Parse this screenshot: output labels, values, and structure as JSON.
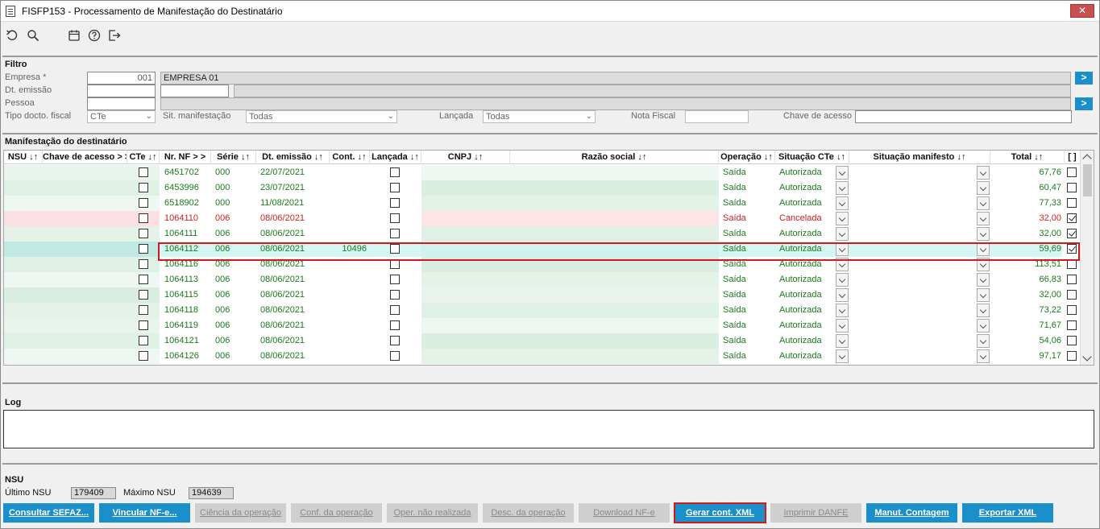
{
  "window": {
    "title": "FISFP153 - Processamento de Manifestação do Destinatário",
    "close_label": "✕"
  },
  "toolbar": {
    "icons": [
      "undo-icon",
      "search-icon",
      "calendar-icon",
      "help-icon",
      "exit-icon"
    ]
  },
  "filtro": {
    "section_title": "Filtro",
    "empresa_label": "Empresa *",
    "empresa_code": "001",
    "empresa_name": "EMPRESA 01",
    "dt_emissao_label": "Dt. emissão",
    "pessoa_label": "Pessoa",
    "tipo_docto_label": "Tipo docto. fiscal",
    "tipo_docto_value": "CTe",
    "sit_manifestacao_label": "Sit. manifestação",
    "sit_manifestacao_value": "Todas",
    "lancada_label": "Lançada",
    "lancada_value": "Todas",
    "nota_fiscal_label": "Nota Fiscal",
    "chave_acesso_label": "Chave de acesso",
    "nav_label": ">"
  },
  "manifestacao": {
    "section_title": "Manifestação do destinatário",
    "columns": {
      "nsu": "NSU ↓↑",
      "chave": "Chave de acesso > >",
      "cte": "CTe ↓↑",
      "nr_nf": "Nr. NF > >",
      "serie": "Série ↓↑",
      "dt_emissao": "Dt. emissão ↓↑",
      "cont": "Cont. ↓↑",
      "lancada": "Lançada ↓↑",
      "cnpj": "CNPJ ↓↑",
      "razao": "Razão social ↓↑",
      "operacao": "Operação ↓↑",
      "situacao_cte": "Situação CTe ↓↑",
      "situacao_manifesto": "Situação manifesto ↓↑",
      "total": "Total ↓↑",
      "sel": "[ ]"
    },
    "rows": [
      {
        "nr_nf": "6451702",
        "serie": "000",
        "dt": "22/07/2021",
        "cont": "",
        "operacao": "Saída",
        "situacao": "Autorizada",
        "total": "67,76",
        "checked": false,
        "status": "normal"
      },
      {
        "nr_nf": "6453996",
        "serie": "000",
        "dt": "23/07/2021",
        "cont": "",
        "operacao": "Saída",
        "situacao": "Autorizada",
        "total": "60,47",
        "checked": false,
        "status": "normal"
      },
      {
        "nr_nf": "6518902",
        "serie": "000",
        "dt": "11/08/2021",
        "cont": "",
        "operacao": "Saída",
        "situacao": "Autorizada",
        "total": "77,33",
        "checked": false,
        "status": "normal"
      },
      {
        "nr_nf": "1064110",
        "serie": "006",
        "dt": "08/06/2021",
        "cont": "",
        "operacao": "Saída",
        "situacao": "Cancelada",
        "total": "32,00",
        "checked": true,
        "status": "cancelled"
      },
      {
        "nr_nf": "1064111",
        "serie": "006",
        "dt": "08/06/2021",
        "cont": "",
        "operacao": "Saída",
        "situacao": "Autorizada",
        "total": "32,00",
        "checked": true,
        "status": "normal"
      },
      {
        "nr_nf": "1064112",
        "serie": "006",
        "dt": "08/06/2021",
        "cont": "10496",
        "operacao": "Saída",
        "situacao": "Autorizada",
        "total": "59,69",
        "checked": true,
        "status": "selected"
      },
      {
        "nr_nf": "1064116",
        "serie": "006",
        "dt": "08/06/2021",
        "cont": "",
        "operacao": "Saída",
        "situacao": "Autorizada",
        "total": "113,51",
        "checked": false,
        "status": "normal"
      },
      {
        "nr_nf": "1064113",
        "serie": "006",
        "dt": "08/06/2021",
        "cont": "",
        "operacao": "Saída",
        "situacao": "Autorizada",
        "total": "66,83",
        "checked": false,
        "status": "normal"
      },
      {
        "nr_nf": "1064115",
        "serie": "006",
        "dt": "08/06/2021",
        "cont": "",
        "operacao": "Saída",
        "situacao": "Autorizada",
        "total": "32,00",
        "checked": false,
        "status": "normal"
      },
      {
        "nr_nf": "1064118",
        "serie": "006",
        "dt": "08/06/2021",
        "cont": "",
        "operacao": "Saída",
        "situacao": "Autorizada",
        "total": "73,22",
        "checked": false,
        "status": "normal"
      },
      {
        "nr_nf": "1064119",
        "serie": "006",
        "dt": "08/06/2021",
        "cont": "",
        "operacao": "Saída",
        "situacao": "Autorizada",
        "total": "71,67",
        "checked": false,
        "status": "normal"
      },
      {
        "nr_nf": "1064121",
        "serie": "006",
        "dt": "08/06/2021",
        "cont": "",
        "operacao": "Saída",
        "situacao": "Autorizada",
        "total": "54,06",
        "checked": false,
        "status": "normal"
      },
      {
        "nr_nf": "1064126",
        "serie": "006",
        "dt": "08/06/2021",
        "cont": "",
        "operacao": "Saída",
        "situacao": "Autorizada",
        "total": "97,17",
        "checked": false,
        "status": "normal"
      }
    ]
  },
  "log": {
    "section_title": "Log"
  },
  "nsu": {
    "section_title": "NSU",
    "ultimo_label": "Último NSU",
    "ultimo_value": "179409",
    "maximo_label": "Máximo NSU",
    "maximo_value": "194639"
  },
  "actions": {
    "consultar_sefaz": "Consultar SEFAZ...",
    "vincular_nfe": "Vincular NF-e...",
    "ciencia_operacao": "Ciência da operação",
    "conf_operacao": "Conf. da operação",
    "oper_nao_realizada": "Oper. não realizada",
    "desc_operacao": "Desc. da operação",
    "download_nfe": "Download NF-e",
    "gerar_cont_xml": "Gerar cont. XML",
    "imprimir_danfe": "Imprimir DANFE",
    "manut_contagem": "Manut. Contagem",
    "exportar_xml": "Exportar XML"
  },
  "colors": {
    "accent": "#1a8fc9",
    "ok_green": "#1a7a1a",
    "cancelled_red": "#cc1f1f",
    "selected_row": "#cff4f2",
    "highlight_outline": "#d11a1a"
  }
}
